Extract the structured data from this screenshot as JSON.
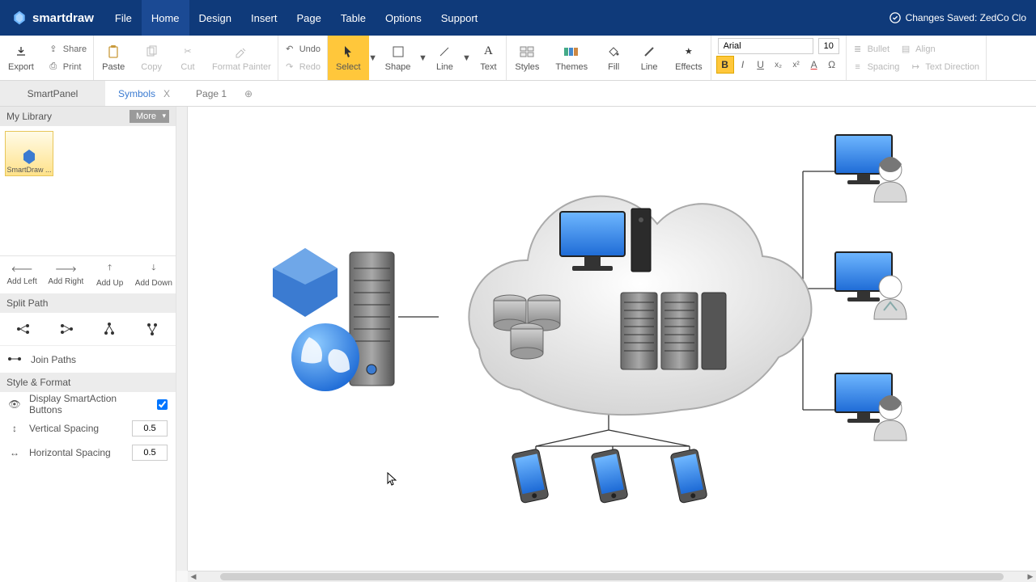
{
  "brand": "smartdraw",
  "menus": [
    "File",
    "Home",
    "Design",
    "Insert",
    "Page",
    "Table",
    "Options",
    "Support"
  ],
  "active_menu": "Home",
  "status_text": "Changes Saved: ZedCo Clo",
  "ribbon": {
    "export": "Export",
    "share": "Share",
    "print": "Print",
    "paste": "Paste",
    "copy": "Copy",
    "cut": "Cut",
    "format_painter": "Format Painter",
    "undo": "Undo",
    "redo": "Redo",
    "select": "Select",
    "shape": "Shape",
    "toolline": "Line",
    "text": "Text",
    "styles": "Styles",
    "themes": "Themes",
    "fill": "Fill",
    "line": "Line",
    "effects": "Effects",
    "font_name": "Arial",
    "font_size": "10",
    "bullet": "Bullet",
    "align": "Align",
    "spacing": "Spacing",
    "text_direction": "Text Direction"
  },
  "left_tab": "SmartPanel",
  "doc_tabs": {
    "symbols": "Symbols",
    "page1": "Page 1"
  },
  "panel": {
    "lib_title": "My Library",
    "lib_more": "More",
    "lib_item": "SmartDraw ...",
    "add_left": "Add Left",
    "add_right": "Add Right",
    "add_up": "Add Up",
    "add_down": "Add Down",
    "split_path": "Split Path",
    "join_paths": "Join Paths",
    "style_format": "Style & Format",
    "display_sa": "Display SmartAction Buttons",
    "v_spacing_label": "Vertical Spacing",
    "v_spacing": "0.5",
    "h_spacing_label": "Horizontal Spacing",
    "h_spacing": "0.5"
  }
}
